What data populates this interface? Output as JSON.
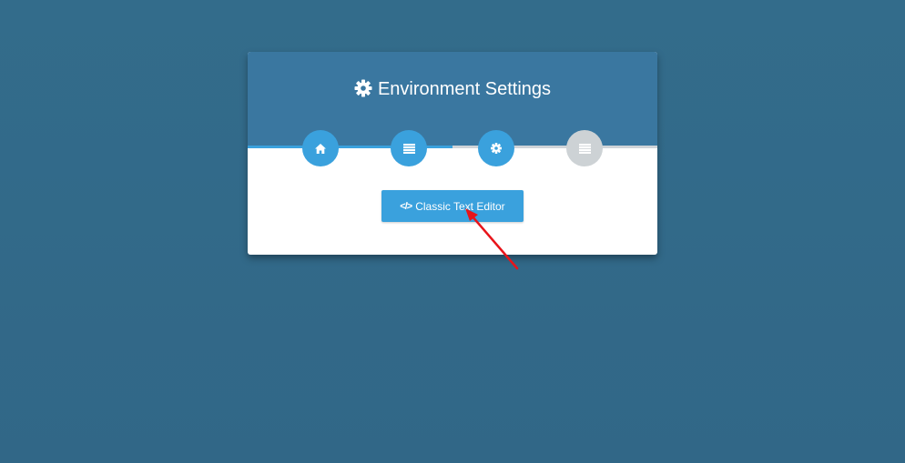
{
  "dialog": {
    "title": "Environment Settings",
    "title_icon": "gear-icon"
  },
  "wizard": {
    "progress": 0.5,
    "steps": [
      {
        "icon": "home-icon",
        "state": "complete"
      },
      {
        "icon": "list-icon",
        "state": "complete"
      },
      {
        "icon": "gear-icon",
        "state": "current"
      },
      {
        "icon": "list-icon",
        "state": "pending"
      }
    ]
  },
  "editor_button": {
    "icon": "code-icon",
    "icon_glyph": "</>",
    "label": "Classic Text Editor"
  },
  "annotation": {
    "arrow_color": "#e8141a"
  },
  "colors": {
    "background": "#336b8a",
    "header": "#3a77a0",
    "accent": "#3aa1dd",
    "inactive": "#cdd2d5"
  }
}
